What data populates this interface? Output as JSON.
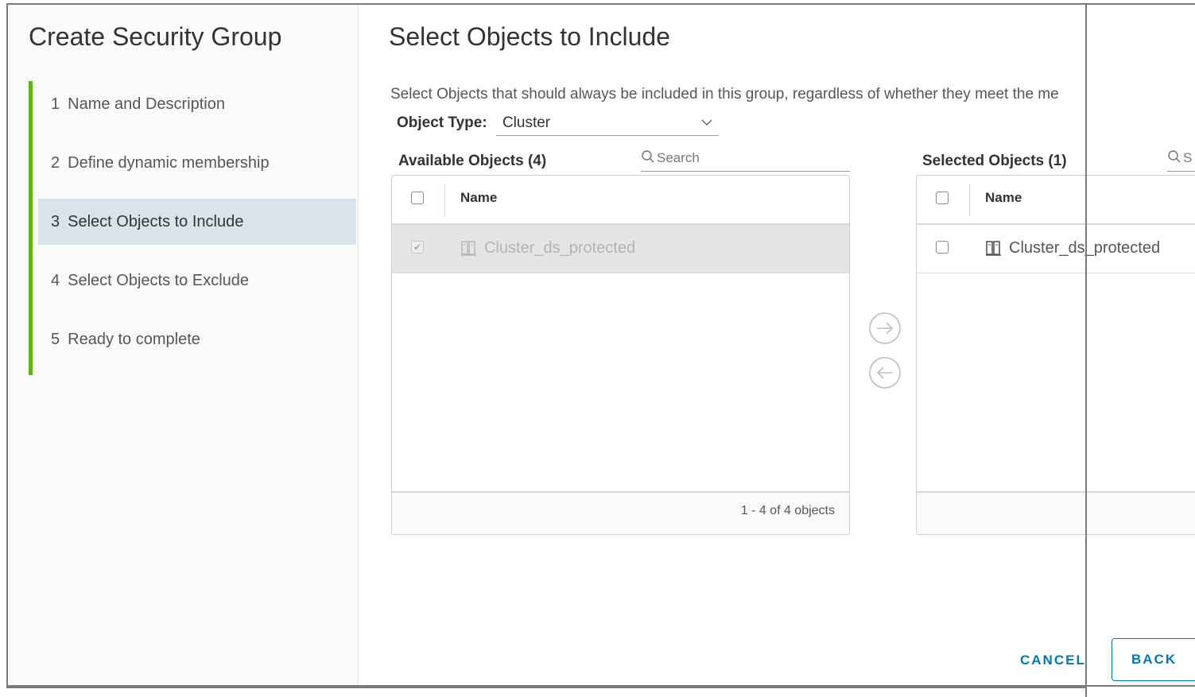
{
  "sidebar": {
    "title": "Create Security Group",
    "steps": [
      {
        "num": "1",
        "label": "Name and Description"
      },
      {
        "num": "2",
        "label": "Define dynamic membership"
      },
      {
        "num": "3",
        "label": "Select Objects to Include"
      },
      {
        "num": "4",
        "label": "Select Objects to Exclude"
      },
      {
        "num": "5",
        "label": "Ready to complete"
      }
    ],
    "active_step": 3,
    "accent_color": "#5eb715"
  },
  "main": {
    "title": "Select Objects to Include",
    "description": "Select Objects that should always be included in this group, regardless of whether they meet the me",
    "object_type_label": "Object Type:",
    "object_type_value": "Cluster",
    "available": {
      "header": "Available Objects (4)",
      "search_placeholder": "Search",
      "column_name": "Name",
      "rows": [
        {
          "name": "Cluster_ds_protected",
          "checked": true,
          "disabled": true,
          "icon": "cluster-icon"
        }
      ],
      "footer": "1 - 4 of 4 objects"
    },
    "selected": {
      "header": "Selected Objects (1)",
      "search_placeholder": "S",
      "column_name": "Name",
      "rows": [
        {
          "name": "Cluster_ds_protected",
          "checked": false,
          "disabled": false,
          "icon": "cluster-icon"
        }
      ]
    }
  },
  "footer_buttons": {
    "cancel": "CANCEL",
    "back": "BACK"
  },
  "colors": {
    "link": "#0079b8",
    "active_step_bg": "#d9e4ea"
  }
}
